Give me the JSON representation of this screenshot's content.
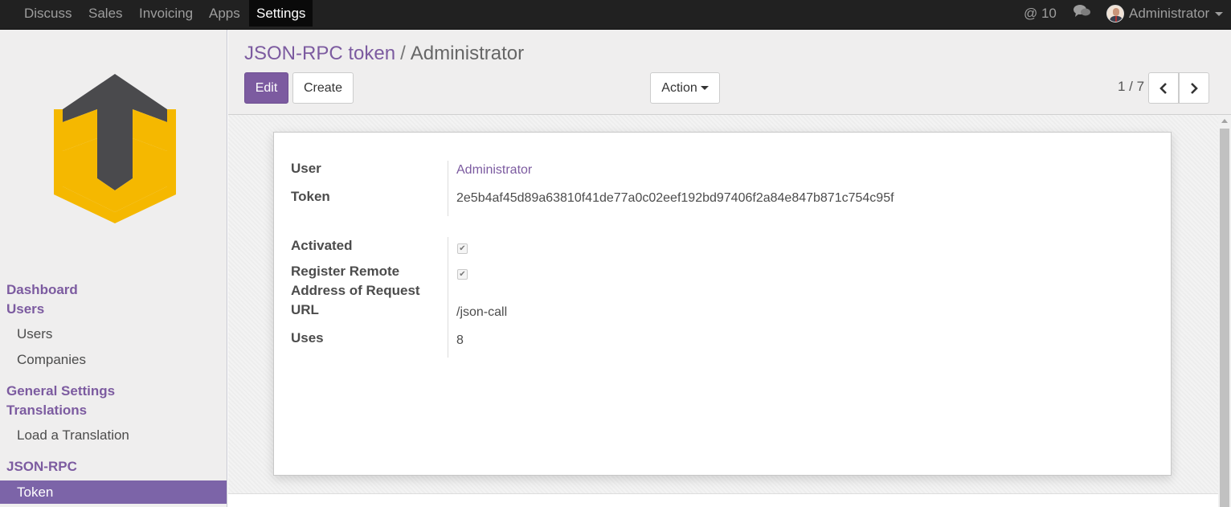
{
  "navbar": {
    "menu": [
      {
        "label": "Discuss"
      },
      {
        "label": "Sales"
      },
      {
        "label": "Invoicing"
      },
      {
        "label": "Apps"
      },
      {
        "label": "Settings",
        "active": true
      }
    ],
    "mentions_icon": "at-icon",
    "mentions_count": "@ 10",
    "chat_icon": "chat-bubbles-icon",
    "user_name": "Administrator"
  },
  "sidebar": {
    "logo": "company-logo",
    "sections": {
      "dashboard": "Dashboard",
      "users_head": "Users",
      "users_item": "Users",
      "companies_item": "Companies",
      "general_settings": "General Settings",
      "translations_head": "Translations",
      "load_translation": "Load a Translation",
      "jsonrpc_head": "JSON-RPC",
      "token_item": "Token"
    }
  },
  "control_panel": {
    "breadcrumb_parent": "JSON-RPC token",
    "breadcrumb_separator": "/",
    "breadcrumb_current": "Administrator",
    "edit_label": "Edit",
    "create_label": "Create",
    "action_label": "Action",
    "pager_value": "1 / 7"
  },
  "form": {
    "user_label": "User",
    "user_value": "Administrator",
    "token_label": "Token",
    "token_value": "2e5b4af45d89a63810f41de77a0c02eef192bd97406f2a84e847b871c754c95f",
    "activated_label": "Activated",
    "activated_checked": true,
    "register_label_1": "Register Remote",
    "register_label_2": "Address of Request",
    "register_checked": true,
    "url_label": "URL",
    "url_value": "/json-call",
    "uses_label": "Uses",
    "uses_value": "8"
  },
  "colors": {
    "brand": "#7c5ba0",
    "navbar": "#212121",
    "sidebar_active": "#7c64a8",
    "logo_dark": "#4a4a4d",
    "logo_yellow": "#f5b800"
  }
}
